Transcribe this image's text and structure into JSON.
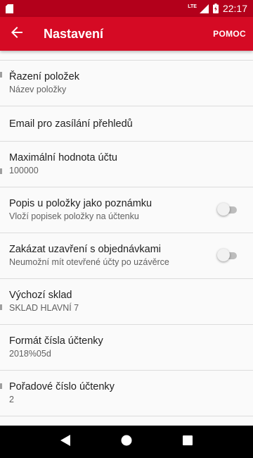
{
  "status_bar": {
    "time": "22:17",
    "network_label": "LTE",
    "icons": [
      "sd-card-icon",
      "signal-icon",
      "battery-charging-icon"
    ]
  },
  "app_bar": {
    "title": "Nastavení",
    "help_label": "POMOC",
    "back_icon": "arrow-back-icon"
  },
  "settings": [
    {
      "title": "Řazení položek",
      "subtitle": "Název položky"
    },
    {
      "title": "Email pro zasílání přehledů"
    },
    {
      "title": "Maximální hodnota účtu",
      "subtitle": "100000"
    },
    {
      "title": "Popis u položky jako poznámku",
      "subtitle": "Vloží popisek položky na účtenku",
      "toggle": false
    },
    {
      "title": "Zakázat uzavření s objednávkami",
      "subtitle": "Neumožní mít otevřené účty po uzávěrce",
      "toggle": false
    },
    {
      "title": "Výchozí sklad",
      "subtitle": "SKLAD HLAVNÍ 7"
    },
    {
      "title": "Formát čísla účtenky",
      "subtitle": "2018%05d"
    },
    {
      "title": "Pořadové číslo účtenky",
      "subtitle": "2"
    }
  ],
  "nav_bar": {
    "icons": [
      "back-triangle-icon",
      "home-circle-icon",
      "recents-square-icon"
    ]
  },
  "colors": {
    "status_bar": "#b3001b",
    "app_bar": "#d50a24",
    "background": "#fafafa",
    "divider": "#dcdcdc"
  }
}
